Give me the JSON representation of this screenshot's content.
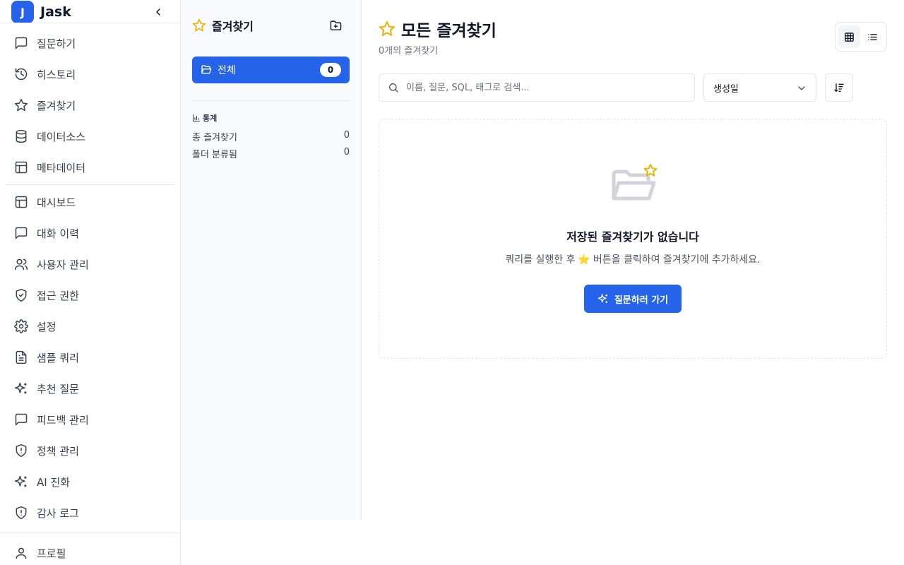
{
  "brand": {
    "logo_letter": "J",
    "name": "Jask"
  },
  "sidebar": {
    "items_top": [
      {
        "label": "질문하기",
        "icon": "message-icon"
      },
      {
        "label": "히스토리",
        "icon": "history-icon"
      },
      {
        "label": "즐겨찾기",
        "icon": "star-icon"
      },
      {
        "label": "데이터소스",
        "icon": "database-icon"
      },
      {
        "label": "메타데이터",
        "icon": "layout-icon"
      }
    ],
    "items_admin": [
      {
        "label": "대시보드",
        "icon": "layout-icon"
      },
      {
        "label": "대화 이력",
        "icon": "message-icon"
      },
      {
        "label": "사용자 관리",
        "icon": "users-icon"
      },
      {
        "label": "접근 권한",
        "icon": "shield-check-icon"
      },
      {
        "label": "설정",
        "icon": "gear-icon"
      },
      {
        "label": "샘플 쿼리",
        "icon": "file-text-icon"
      },
      {
        "label": "추천 질문",
        "icon": "sparkles-icon"
      },
      {
        "label": "피드백 관리",
        "icon": "message-icon"
      },
      {
        "label": "정책 관리",
        "icon": "shield-alert-icon"
      },
      {
        "label": "AI 진화",
        "icon": "sparkles-icon"
      },
      {
        "label": "감사 로그",
        "icon": "shield-alert-icon"
      }
    ],
    "profile": {
      "label": "프로필",
      "icon": "user-icon"
    }
  },
  "folder_panel": {
    "title": "즐겨찾기",
    "all_folder": {
      "label": "전체",
      "count": "0"
    },
    "stats": {
      "title": "통계",
      "rows": [
        {
          "label": "총 즐겨찾기",
          "value": "0"
        },
        {
          "label": "폴더 분류됨",
          "value": "0"
        }
      ]
    }
  },
  "main": {
    "title": "모든 즐겨찾기",
    "subtitle": "0개의 즐겨찾기",
    "search_placeholder": "이름, 질문, SQL, 태그로 검색...",
    "sort_selected": "생성일",
    "empty": {
      "title": "저장된 즐겨찾기가 없습니다",
      "desc_before": "쿼리를 실행한 후",
      "desc_star": "⭐",
      "desc_after": "버튼을 클릭하여 즐겨찾기에 추가하세요.",
      "cta_label": "질문하러 가기"
    }
  },
  "colors": {
    "accent": "#2563eb",
    "star": "#eab308"
  }
}
